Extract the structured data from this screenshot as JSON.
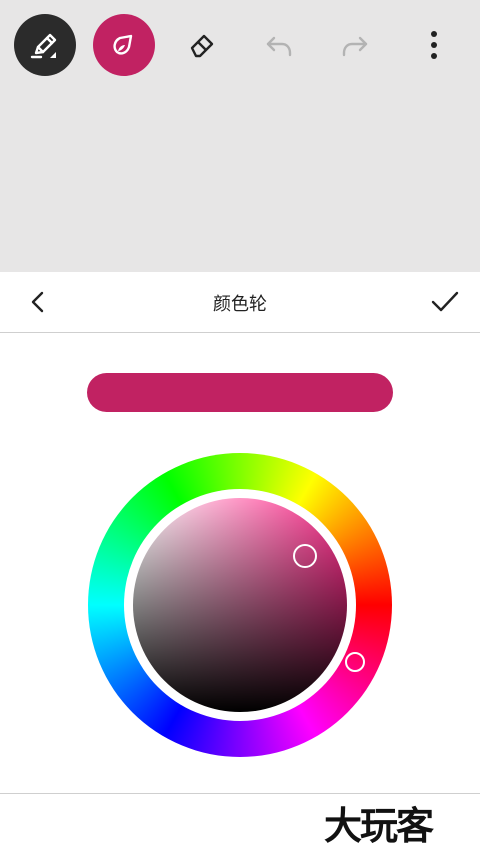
{
  "toolbar": {
    "tools": [
      {
        "icon": "pen-icon",
        "selected": true
      },
      {
        "icon": "color-drop-icon",
        "selected": true
      },
      {
        "icon": "eraser-icon",
        "selected": false
      },
      {
        "icon": "undo-icon",
        "enabled": false
      },
      {
        "icon": "redo-icon",
        "enabled": false
      },
      {
        "icon": "more-vert-icon"
      }
    ]
  },
  "panel": {
    "title": "颜色轮",
    "back_icon": "chevron-left-icon",
    "confirm_icon": "check-icon"
  },
  "color": {
    "selected": "#c12262",
    "wheel_hue_color": "#ff2d8c"
  },
  "watermark": {
    "text": "大玩客"
  },
  "colors": {
    "canvas_background": "#e7e6e6",
    "pen_button": "#2b2b2b",
    "accent": "#c12262"
  }
}
